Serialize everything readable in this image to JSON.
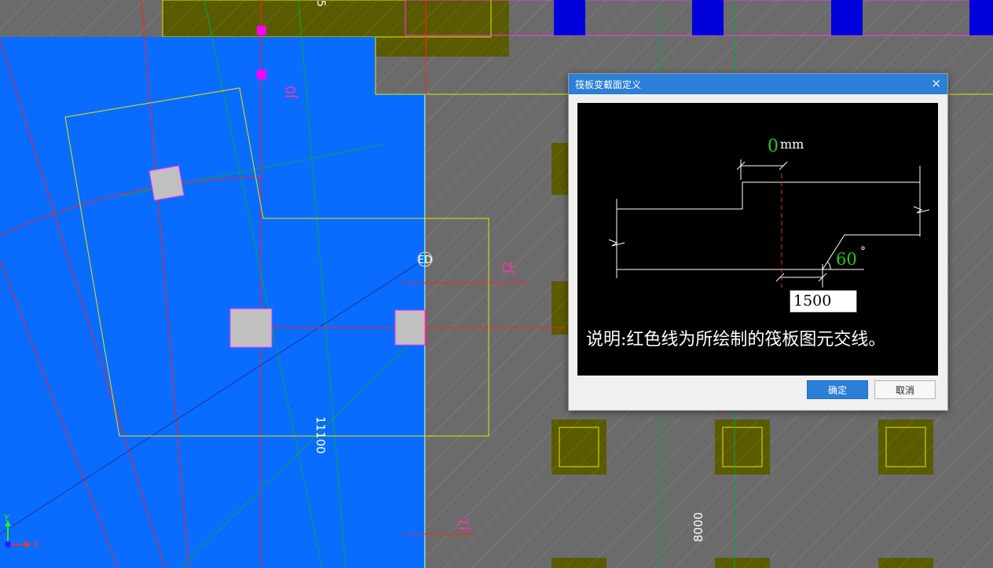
{
  "canvas": {
    "dim_labels": [
      "11100",
      "8000",
      "5",
      "J0"
    ],
    "axis_labels": [
      "J2",
      "J1"
    ],
    "point_label": "ED",
    "axes": {
      "y": "Y",
      "x": "X"
    }
  },
  "dialog": {
    "title": "筏板变截面定义",
    "close_glyph": "×",
    "preview": {
      "offset_value": "0",
      "offset_unit": "mm",
      "angle_value": "60",
      "angle_unit": "°",
      "width_value": "1500",
      "note": "说明:红色线为所绘制的筏板图元交线。"
    },
    "ok_label": "确定",
    "cancel_label": "取消"
  },
  "colors": {
    "blue_slab": "#0a6cff",
    "dark_olive": "#5a5a00",
    "accent": "#2b7fd6",
    "green_text": "#22cc22"
  }
}
